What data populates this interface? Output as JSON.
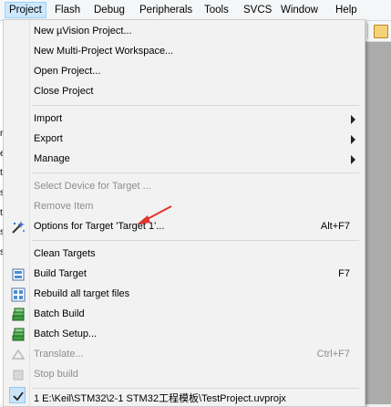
{
  "menubar": {
    "items": [
      "Project",
      "Flash",
      "Debug",
      "Peripherals",
      "Tools",
      "SVCS",
      "Window",
      "Help"
    ]
  },
  "menu": {
    "new_uvision_project": "New µVision Project...",
    "new_multi_project_workspace": "New Multi-Project Workspace...",
    "open_project": "Open Project...",
    "close_project": "Close Project",
    "import": "Import",
    "export": "Export",
    "manage": "Manage",
    "select_device": "Select Device for Target ...",
    "remove_item": "Remove Item",
    "options_for_target": "Options for Target 'Target 1'...",
    "options_for_target_shortcut": "Alt+F7",
    "clean_targets": "Clean Targets",
    "build_target": "Build Target",
    "build_target_shortcut": "F7",
    "rebuild_all": "Rebuild all target files",
    "batch_build": "Batch Build",
    "batch_setup": "Batch Setup...",
    "translate": "Translate...",
    "translate_shortcut": "Ctrl+F7",
    "stop_build": "Stop build",
    "recent_project": "1 E:\\Keil\\STM32\\2-1 STM32工程模板\\TestProject.uvprojx"
  },
  "background": {
    "left_strip_chars": [
      "r",
      "e",
      "t",
      "s",
      "t",
      "s",
      "s"
    ]
  },
  "colors": {
    "menu_bg": "#f2f2f2",
    "active_menubar": "#cce8ff",
    "disabled_text": "#8d8d8d",
    "annotation_arrow": "#e0352b"
  }
}
